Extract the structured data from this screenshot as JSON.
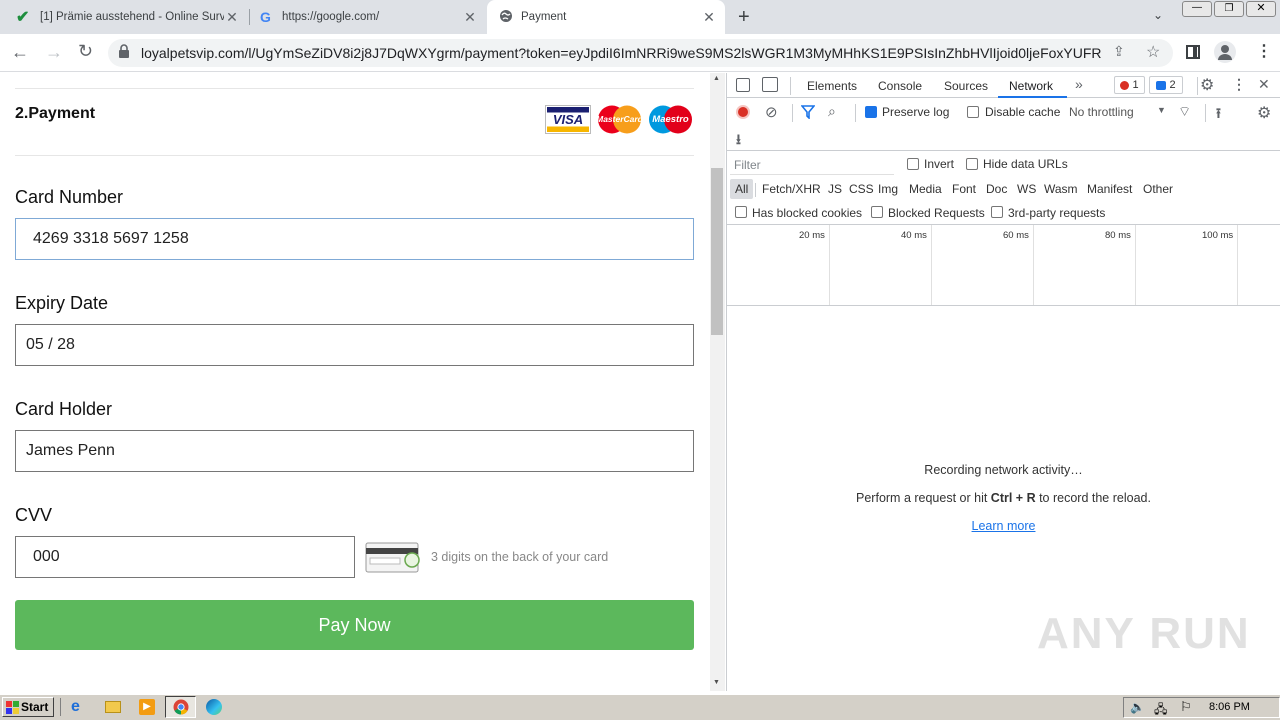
{
  "browser": {
    "tabs": [
      {
        "title": "[1] Prämie ausstehend - Online Surv",
        "icon": "check-icon"
      },
      {
        "title": "https://google.com/",
        "icon": "google-icon"
      },
      {
        "title": "Payment",
        "icon": "globe-icon"
      }
    ],
    "new_tab": "+",
    "url": "loyalpetsvip.com/l/UgYmSeZiDV8i2j8J7DqWXYgrm/payment?token=eyJpdiI6ImNRRi9weS9MS2lsWGR1M3MyMHhKS1E9PSIsInZhbHVlIjoid0ljeFoxYUFRNEF..."
  },
  "payment": {
    "section_title": "2.Payment",
    "card_logos": [
      "VISA",
      "MasterCard",
      "Maestro"
    ],
    "card_number_label": "Card Number",
    "card_number_value": "4269 3318 5697 1258",
    "expiry_label": "Expiry Date",
    "expiry_value": "05 / 28",
    "holder_label": "Card Holder",
    "holder_value": "James Penn",
    "cvv_label": "CVV",
    "cvv_value": "000",
    "cvv_hint": "3 digits on the back of your card",
    "pay_button": "Pay Now",
    "pay_color": "#5cb85c"
  },
  "devtools": {
    "tabs": [
      "Elements",
      "Console",
      "Sources",
      "Network"
    ],
    "active_tab": "Network",
    "more": "»",
    "error_count": "1",
    "message_count": "2",
    "preserve_log": "Preserve log",
    "disable_cache": "Disable cache",
    "throttling": "No throttling",
    "filter_placeholder": "Filter",
    "invert": "Invert",
    "hide_data_urls": "Hide data URLs",
    "type_filters": [
      "All",
      "Fetch/XHR",
      "JS",
      "CSS",
      "Img",
      "Media",
      "Font",
      "Doc",
      "WS",
      "Wasm",
      "Manifest",
      "Other"
    ],
    "has_blocked_cookies": "Has blocked cookies",
    "blocked_requests": "Blocked Requests",
    "third_party": "3rd-party requests",
    "timeline_ticks": [
      "20 ms",
      "40 ms",
      "60 ms",
      "80 ms",
      "100 ms"
    ],
    "recording": "Recording network activity…",
    "perform_prefix": "Perform a request or hit ",
    "perform_keys": "Ctrl + R",
    "perform_suffix": " to record the reload.",
    "learn_more": "Learn more"
  },
  "watermark": "ANY RUN",
  "taskbar": {
    "start": "Start",
    "clock": "8:06 PM",
    "apps": [
      "ie-icon",
      "folder-icon",
      "media-icon",
      "chrome-icon",
      "edge-icon"
    ]
  }
}
